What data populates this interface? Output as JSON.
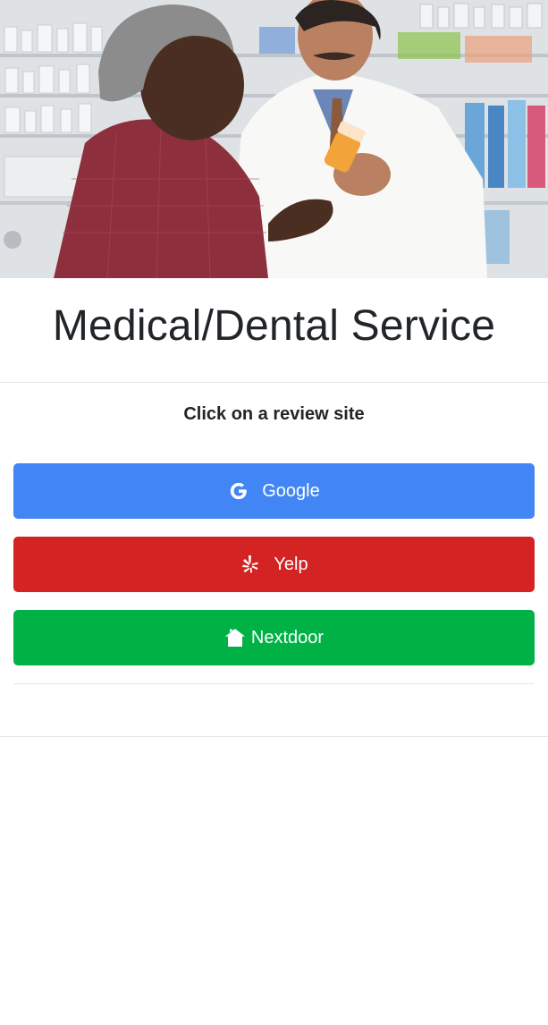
{
  "hero": {
    "image_alt": "pharmacist-with-customer-photo"
  },
  "header": {
    "title": "Medical/Dental Service"
  },
  "prompt": {
    "text": "Click on a review site"
  },
  "buttons": [
    {
      "label": "Google",
      "icon": "google-icon",
      "color": "#4285f4"
    },
    {
      "label": "Yelp",
      "icon": "yelp-icon",
      "color": "#d32323"
    },
    {
      "label": "Nextdoor",
      "icon": "house-icon",
      "color": "#00b246"
    }
  ]
}
